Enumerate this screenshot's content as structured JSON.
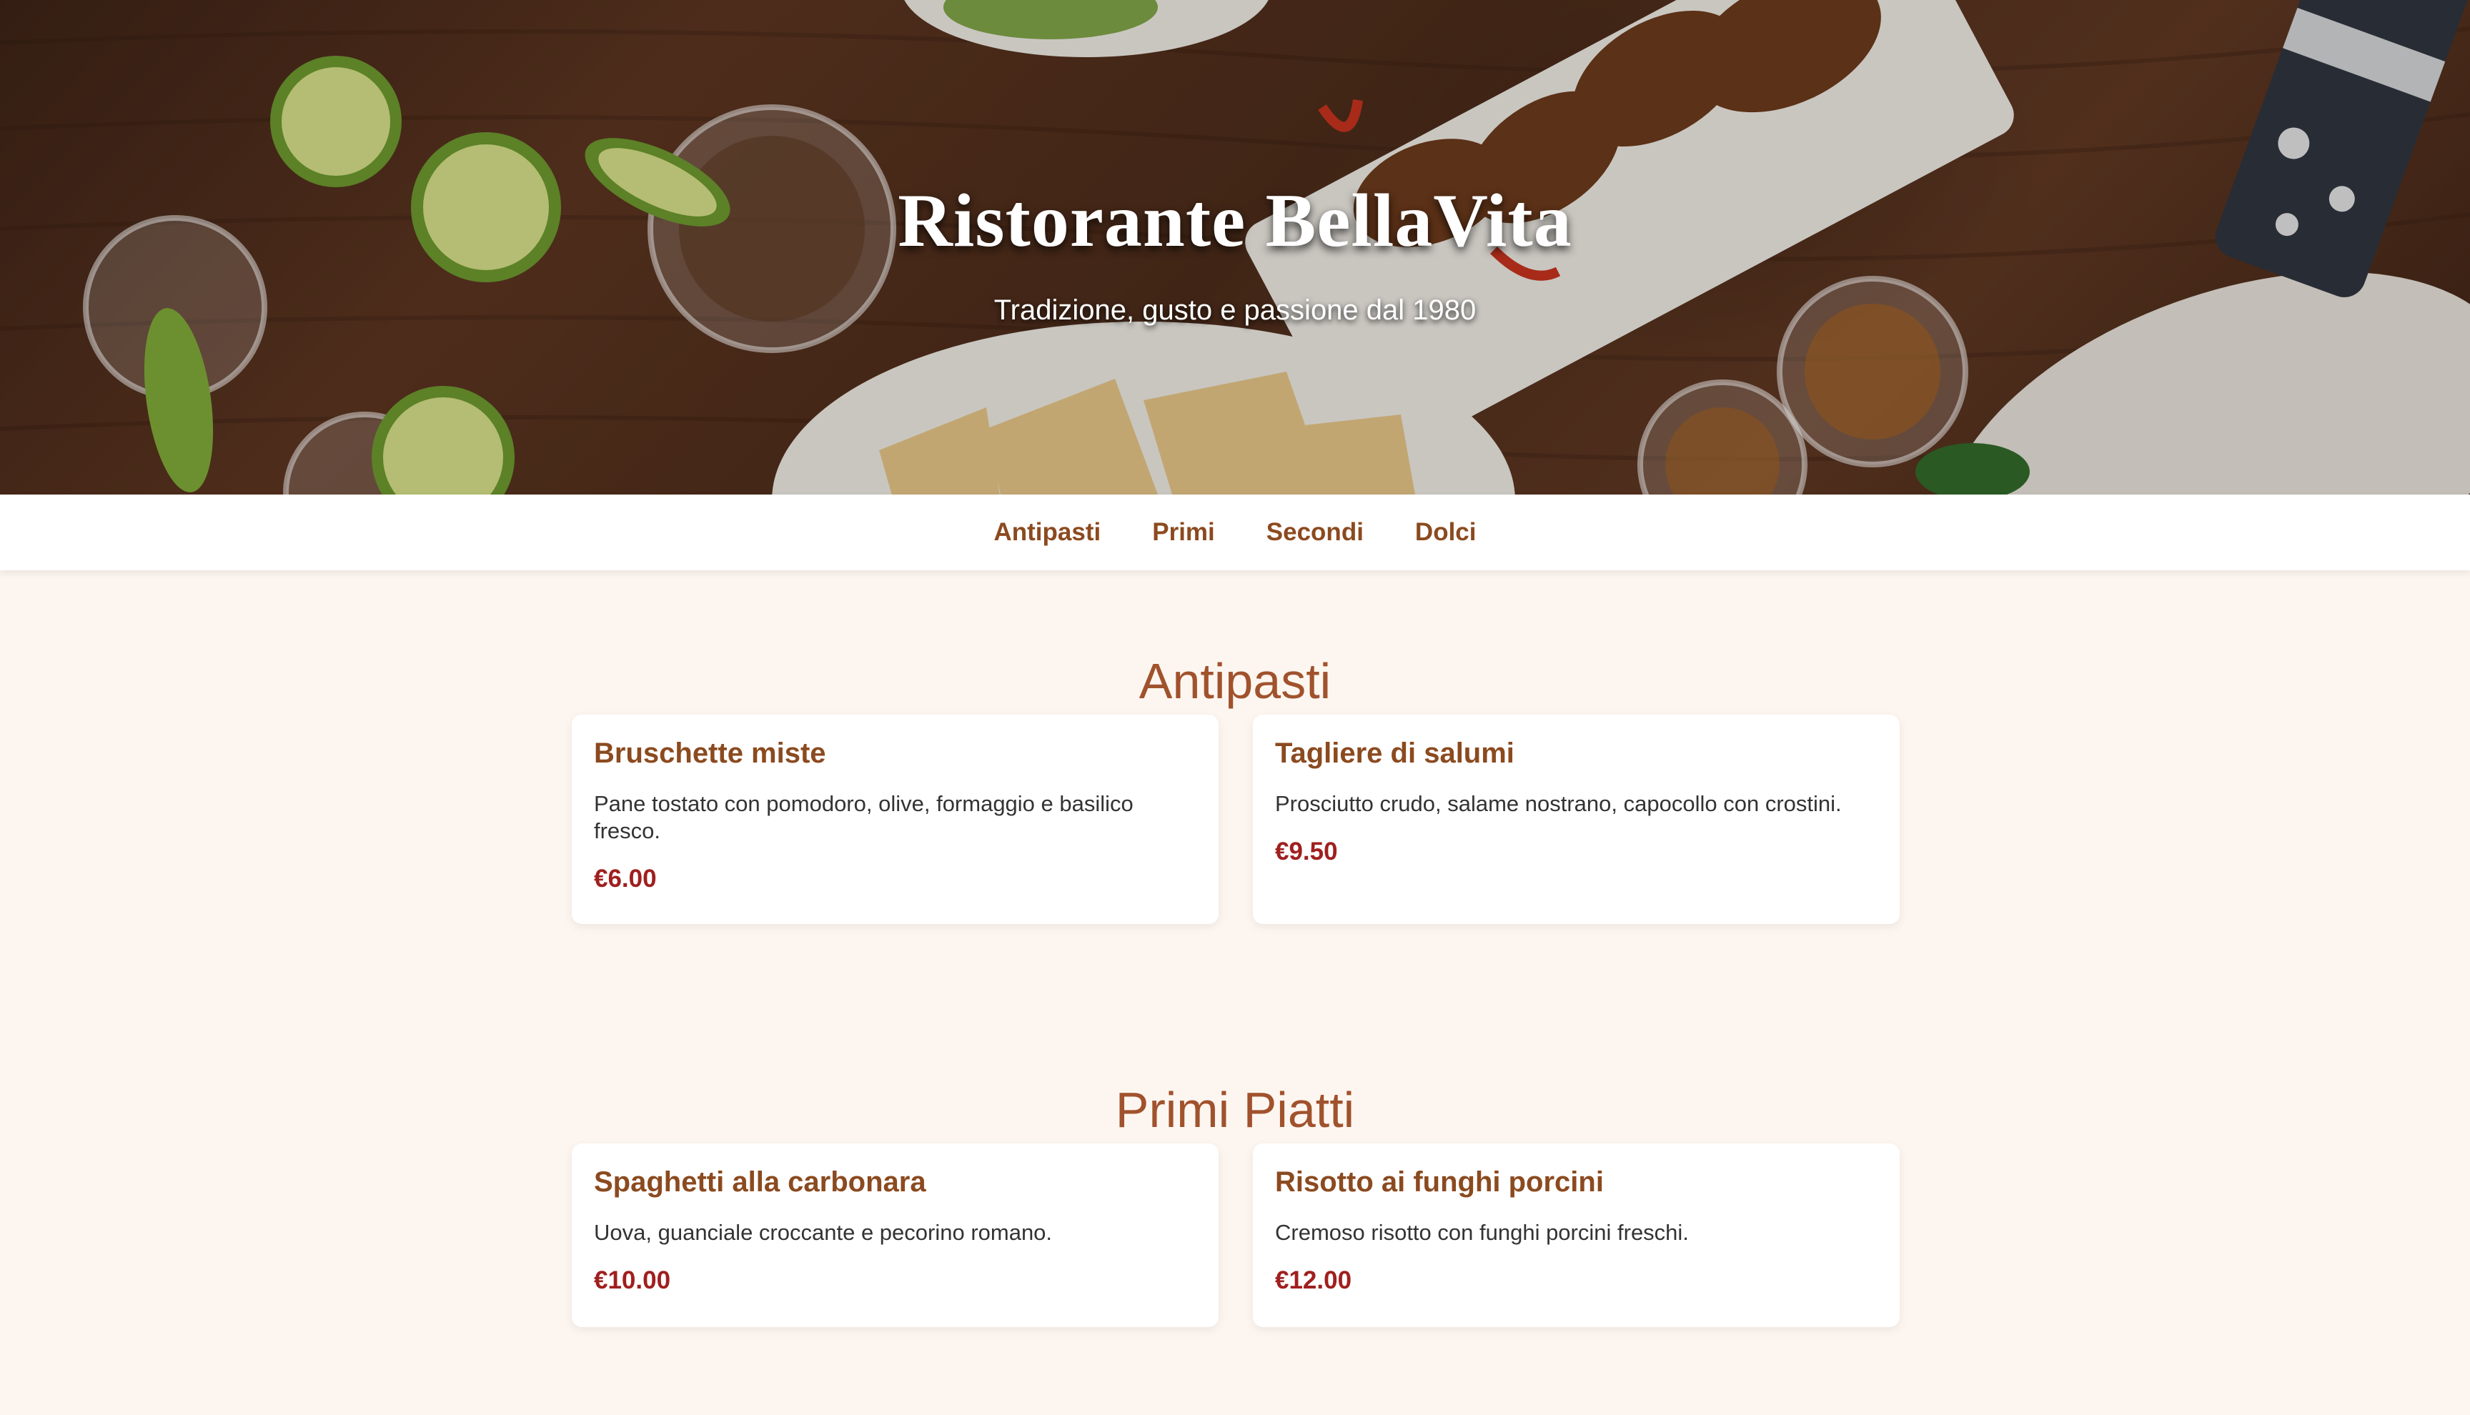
{
  "hero": {
    "title": "Ristorante BellaVita",
    "subtitle": "Tradizione, gusto e passione dal 1980",
    "photo_colors": {
      "wood": "#4a2b1a",
      "plate": "#f1efe9",
      "lime": "#b9d35a",
      "wings": "#6b3a1c"
    }
  },
  "nav": {
    "items": [
      {
        "label": "Antipasti"
      },
      {
        "label": "Primi"
      },
      {
        "label": "Secondi"
      },
      {
        "label": "Dolci"
      }
    ]
  },
  "sections": [
    {
      "title": "Antipasti",
      "dishes": [
        {
          "name": "Bruschette miste",
          "description": "Pane tostato con pomodoro, olive, formaggio e basilico fresco.",
          "price": "€6.00"
        },
        {
          "name": "Tagliere di salumi",
          "description": "Prosciutto crudo, salame nostrano, capocollo con crostini.",
          "price": "€9.50"
        }
      ]
    },
    {
      "title": "Primi Piatti",
      "dishes": [
        {
          "name": "Spaghetti alla carbonara",
          "description": "Uova, guanciale croccante e pecorino romano.",
          "price": "€10.00"
        },
        {
          "name": "Risotto ai funghi porcini",
          "description": "Cremoso risotto con funghi porcini freschi.",
          "price": "€12.00"
        }
      ]
    }
  ],
  "colors": {
    "page_background": "#fdf6f0",
    "accent_brown": "#8b4a1f",
    "section_heading": "#a0522d",
    "price_red": "#a01f1f"
  }
}
